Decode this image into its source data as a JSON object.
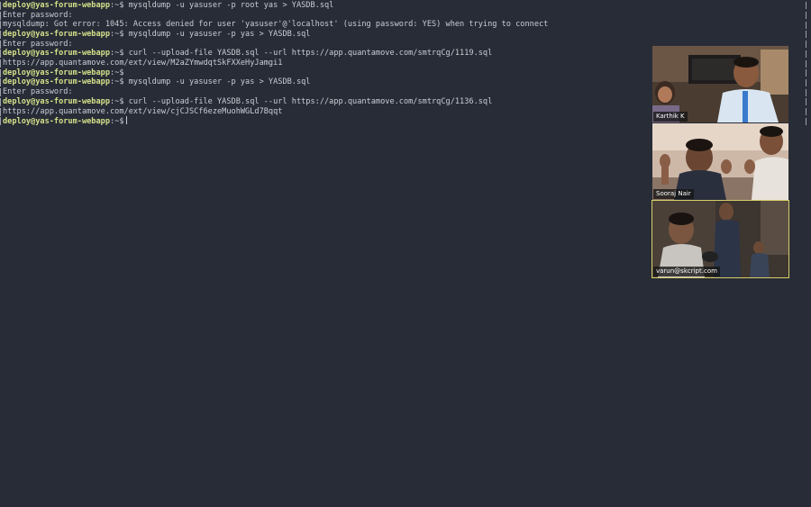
{
  "terminal": {
    "prompt": {
      "user_host": "deploy@yas-forum-webapp",
      "path": ":~$"
    },
    "lines": [
      {
        "kind": "prompt",
        "command": "mysqldump -u yasuser -p root yas > YASDB.sql"
      },
      {
        "kind": "output",
        "text": "Enter password:"
      },
      {
        "kind": "output",
        "text": "mysqldump: Got error: 1045: Access denied for user 'yasuser'@'localhost' (using password: YES) when trying to connect"
      },
      {
        "kind": "prompt",
        "command": "mysqldump -u yasuser -p yas > YASDB.sql"
      },
      {
        "kind": "output",
        "text": "Enter password:"
      },
      {
        "kind": "prompt",
        "command": "curl --upload-file YASDB.sql --url https://app.quantamove.com/smtrqCg/1119.sql"
      },
      {
        "kind": "output",
        "text": "https://app.quantamove.com/ext/view/M2aZYmwdqtSkFXXeHyJamgi1"
      },
      {
        "kind": "prompt",
        "command": ""
      },
      {
        "kind": "prompt",
        "command": "mysqldump -u yasuser -p yas > YASDB.sql"
      },
      {
        "kind": "output",
        "text": "Enter password:"
      },
      {
        "kind": "prompt",
        "command": "curl --upload-file YASDB.sql --url https://app.quantamove.com/smtrqCg/1136.sql"
      },
      {
        "kind": "output",
        "text": "https://app.quantamove.com/ext/view/cjCJSCf6ezeMuohWGLd7Bqqt"
      },
      {
        "kind": "prompt",
        "command": "",
        "cursor": true
      }
    ]
  },
  "participants": [
    {
      "name": "Karthik K",
      "active": false
    },
    {
      "name": "Sooraj Nair",
      "active": false
    },
    {
      "name": "varun@skcript.com",
      "active": true
    }
  ],
  "colors": {
    "background": "#282c36",
    "prompt": "#d3e08a",
    "text": "#c8cdd6",
    "active_speaker_border": "#d7cf6a"
  }
}
